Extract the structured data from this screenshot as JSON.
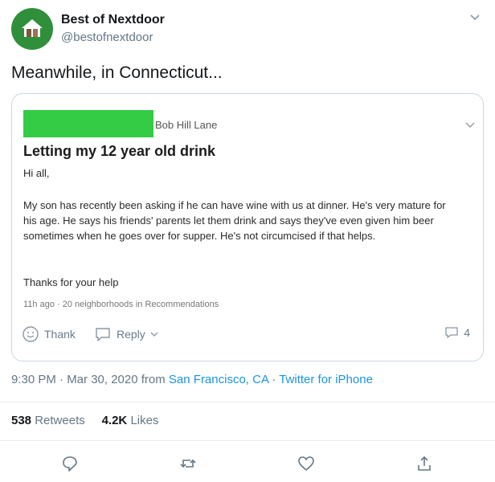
{
  "tweet": {
    "display_name": "Best of Nextdoor",
    "handle": "@bestofnextdoor",
    "text": "Meanwhile, in Connecticut...",
    "timestamp": "9:30 PM · Mar 30, 2020 from ",
    "location": "San Francisco, CA",
    "sep": " · ",
    "client": "Twitter for iPhone",
    "retweets_count": "538",
    "retweets_label": "Retweets",
    "likes_count": "4.2K",
    "likes_label": "Likes"
  },
  "card": {
    "street": "Bob Hill Lane",
    "title": "Letting my 12 year old drink",
    "greeting": "Hi all,",
    "body": "My son has recently been asking if he can have wine with us at dinner. He's very mature for his age. He says his friends' parents let them drink and says they've even given him beer sometimes when he goes over for supper. He's not circumcised if that helps.",
    "thanks": "Thanks for your help",
    "meta": "11h ago · 20 neighborhoods in Recommendations",
    "thank_label": "Thank",
    "reply_label": "Reply",
    "comment_count": "4"
  },
  "colors": {
    "accent": "#1b95e0",
    "redaction": "#33cc44",
    "avatar_bg": "#2f8f3a"
  },
  "icons": [
    "nextdoor-house-icon",
    "chevron-down-icon",
    "smiley-icon",
    "speech-bubble-icon",
    "comment-icon",
    "reply-icon",
    "retweet-icon",
    "heart-icon",
    "share-icon"
  ]
}
